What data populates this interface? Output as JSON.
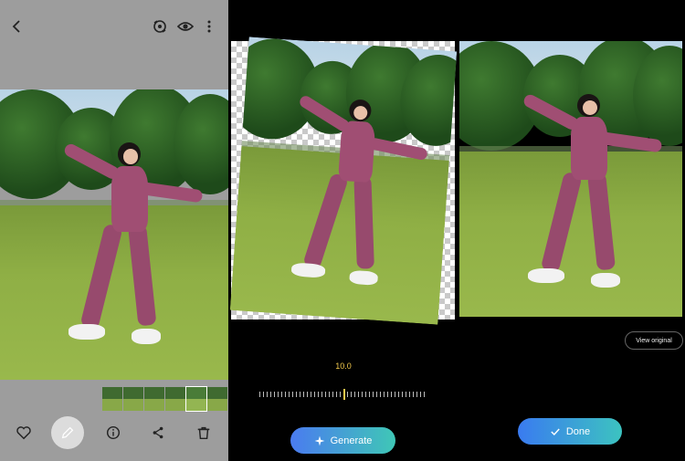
{
  "gallery": {
    "back_icon": "chevron-left-icon",
    "top_icons": [
      "remaster-icon",
      "eye-icon",
      "more-vert-icon"
    ],
    "bottom_icons": [
      "heart-icon",
      "pencil-icon",
      "info-icon",
      "share-icon",
      "trash-icon"
    ]
  },
  "editor": {
    "slider_value": "10.0",
    "generate_label": "Generate"
  },
  "result": {
    "view_original_label": "View original",
    "done_label": "Done"
  },
  "colors": {
    "accent_yellow": "#f2c94c",
    "gradient_blue": "#4a7bf0",
    "gradient_teal": "#3fc7b6"
  }
}
